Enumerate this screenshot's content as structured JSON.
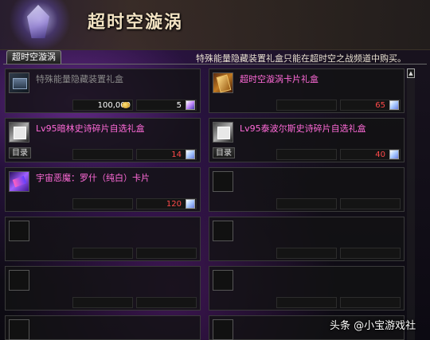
{
  "header": {
    "title": "超时空漩涡"
  },
  "tab": {
    "label": "超时空漩涡"
  },
  "notice": "特殊能量隐藏装置礼盒只能在超时空之战频道中购买。",
  "slots": [
    {
      "name": "特殊能量隐藏装置礼盒",
      "price": "100,000",
      "count": "5",
      "catalog": ""
    },
    {
      "name": "超时空漩涡卡片礼盒",
      "price": "",
      "count": "65",
      "catalog": ""
    },
    {
      "name": "Lv95暗林史诗碎片自选礼盒",
      "price": "",
      "count": "14",
      "catalog": "目录"
    },
    {
      "name": "Lv95泰波尔斯史诗碎片自选礼盒",
      "price": "",
      "count": "40",
      "catalog": "目录"
    },
    {
      "name": "宇宙恶魔：罗什（纯白）卡片",
      "price": "",
      "count": "120",
      "catalog": ""
    }
  ],
  "watermark": "头条 @小宝游戏社"
}
